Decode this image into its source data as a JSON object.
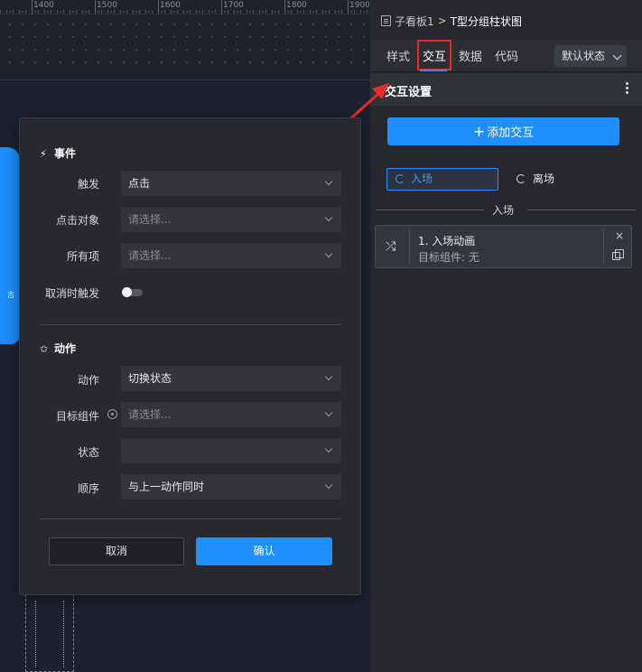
{
  "ruler": {
    "ticks": [
      "1400",
      "1500",
      "1600",
      "1700",
      "1800",
      "1900"
    ]
  },
  "canvas": {
    "map_label": "吉"
  },
  "breadcrumb": {
    "parent": "子看板1",
    "separator": ">",
    "current": "T型分组柱状图"
  },
  "tabs": [
    {
      "label": "样式"
    },
    {
      "label": "交互"
    },
    {
      "label": "数据"
    },
    {
      "label": "代码"
    }
  ],
  "state_select": {
    "value": "默认状态"
  },
  "section": {
    "title": "交互设置"
  },
  "add_button": {
    "label": "添加交互",
    "plus": "+"
  },
  "segments": {
    "enter": "入场",
    "leave": "离场"
  },
  "divider": {
    "label": "入场"
  },
  "anim_card": {
    "title": "1. 入场动画",
    "subtitle": "目标组件: 无",
    "close": "×"
  },
  "modal": {
    "event_group": {
      "title": "事件"
    },
    "trigger": {
      "label": "触发",
      "value": "点击"
    },
    "click_target": {
      "label": "点击对象",
      "placeholder": "请选择..."
    },
    "all_items": {
      "label": "所有项",
      "placeholder": "请选择..."
    },
    "cancel_trigger": {
      "label": "取消时触发"
    },
    "action_group": {
      "title": "动作"
    },
    "action": {
      "label": "动作",
      "value": "切换状态"
    },
    "target_component": {
      "label": "目标组件",
      "placeholder": "请选择..."
    },
    "state": {
      "label": "状态",
      "value": ""
    },
    "order": {
      "label": "顺序",
      "value": "与上一动作同时"
    },
    "cancel_button": "取消",
    "ok_button": "确认"
  },
  "colors": {
    "accent": "#1f8fff",
    "highlight": "#e8292a",
    "panel": "#26282d",
    "canvas": "#1b2130"
  }
}
